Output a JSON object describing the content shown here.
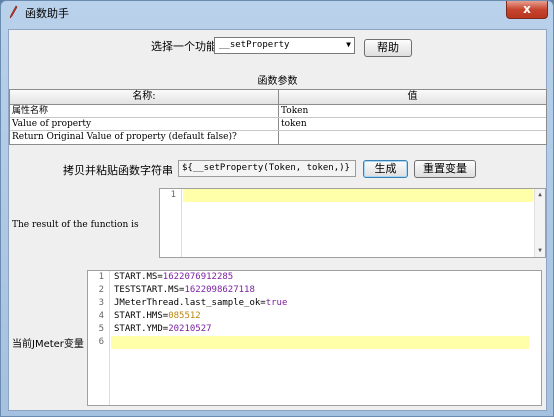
{
  "window": {
    "title": "函数助手",
    "close_label": "x"
  },
  "selector": {
    "label": "选择一个功能",
    "value": "__setProperty",
    "help_label": "帮助"
  },
  "params": {
    "caption": "函数参数",
    "headers": [
      "名称:",
      "值"
    ],
    "rows": [
      {
        "name": "属性名称",
        "value": "Token"
      },
      {
        "name": "Value of property",
        "value": "token"
      },
      {
        "name": "Return Original Value of property (default false)?",
        "value": ""
      }
    ]
  },
  "generate": {
    "label": "拷贝并粘贴函数字符串",
    "value": "${__setProperty(Token, token,)}",
    "generate_label": "生成",
    "reset_label": "重置变量"
  },
  "result": {
    "label": "The result of the function is",
    "line_numbers": [
      "1"
    ],
    "lines": [
      ""
    ]
  },
  "vars": {
    "label": "当前JMeter变量",
    "line_numbers": [
      "1",
      "2",
      "3",
      "4",
      "5",
      "6"
    ],
    "lines": [
      {
        "key": "START.MS=",
        "value": "1622076912285"
      },
      {
        "key": "TESTSTART.MS=",
        "value": "1622098627118"
      },
      {
        "key": "JMeterThread.last_sample_ok=",
        "value": "true"
      },
      {
        "key": "START.HMS=",
        "value": "085512"
      },
      {
        "key": "START.YMD=",
        "value": "20210527"
      },
      {
        "key": "",
        "value": ""
      }
    ]
  },
  "colors": {
    "highlight_line": "#ffffaa",
    "value_text": "#7b1fa2",
    "close_button": "#c7452f"
  }
}
